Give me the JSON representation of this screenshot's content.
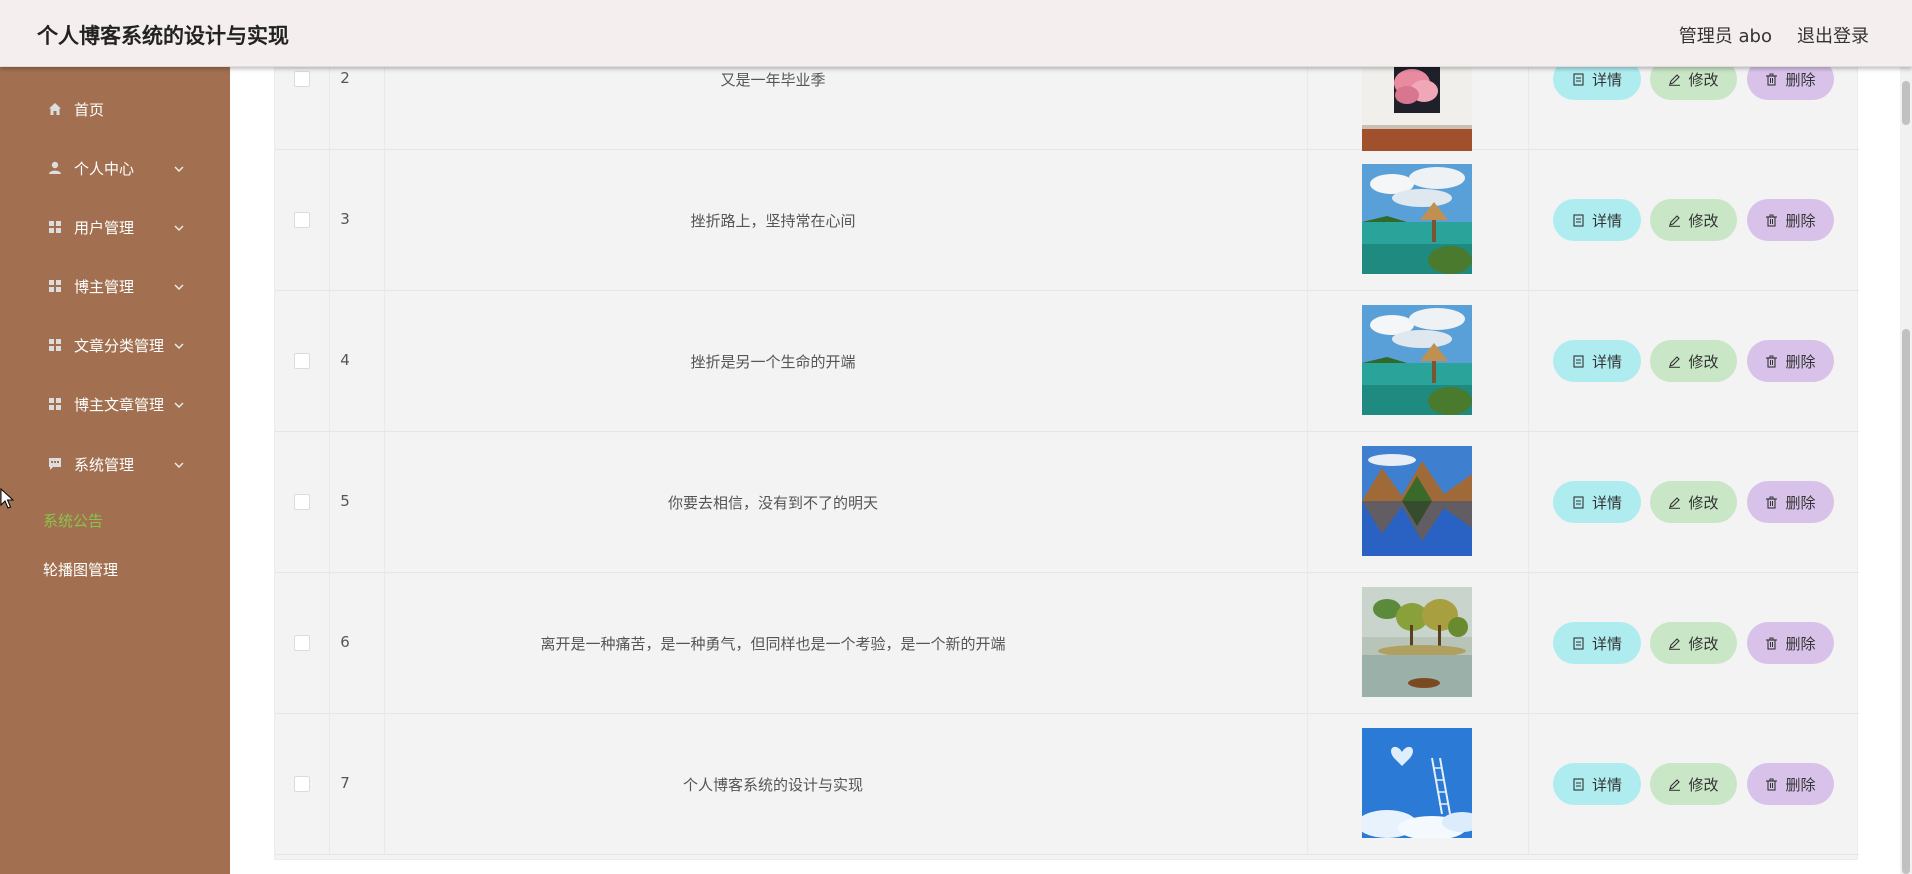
{
  "header": {
    "title": "个人博客系统的设计与实现",
    "admin": "管理员 abo",
    "logout": "退出登录"
  },
  "sidebar": {
    "items": [
      {
        "label": "首页",
        "icon": "home-icon"
      },
      {
        "label": "个人中心",
        "icon": "user-icon"
      },
      {
        "label": "用户管理",
        "icon": "grid-icon"
      },
      {
        "label": "博主管理",
        "icon": "grid-icon"
      },
      {
        "label": "文章分类管理",
        "icon": "grid-icon"
      },
      {
        "label": "博主文章管理",
        "icon": "grid-icon"
      },
      {
        "label": "系统管理",
        "icon": "chat-icon"
      }
    ],
    "subitems": [
      {
        "label": "系统公告",
        "active": true
      },
      {
        "label": "轮播图管理",
        "active": false
      }
    ]
  },
  "table": {
    "rows": [
      {
        "index": "2",
        "title": "又是一年毕业季",
        "image": "pink-cloud-frame"
      },
      {
        "index": "3",
        "title": "挫折路上，坚持常在心间",
        "image": "tropical-hut"
      },
      {
        "index": "4",
        "title": "挫折是另一个生命的开端",
        "image": "tropical-hut"
      },
      {
        "index": "5",
        "title": "你要去相信，没有到不了的明天",
        "image": "mountain-lake"
      },
      {
        "index": "6",
        "title": "离开是一种痛苦，是一种勇气，但同样也是一个考验，是一个新的开端",
        "image": "tree-island"
      },
      {
        "index": "7",
        "title": "个人博客系统的设计与实现",
        "image": "sky-ladder"
      }
    ],
    "actions": {
      "detail": "详情",
      "edit": "修改",
      "delete": "删除"
    }
  },
  "colors": {
    "sidebar": "#a27050",
    "header": "#f5eeee",
    "detail_btn": "#aeecf0",
    "edit_btn": "#c9e6c6",
    "delete_btn": "#d8c2ea",
    "active_submenu": "#8bc34a"
  }
}
